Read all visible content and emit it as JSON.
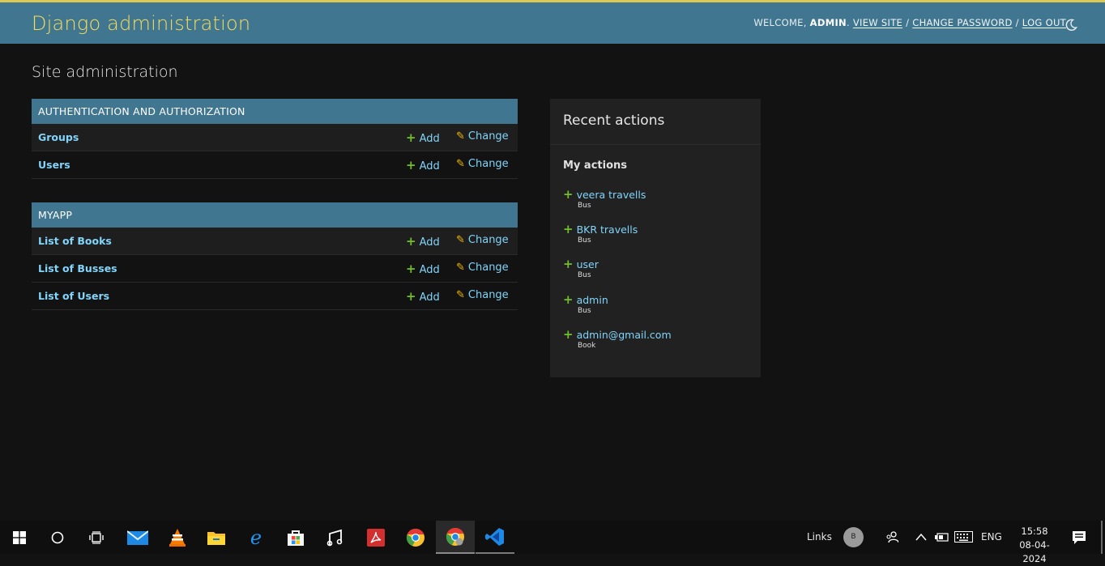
{
  "header": {
    "brand": "Django administration",
    "welcome": "WELCOME,",
    "username": "ADMIN",
    "view_site": "VIEW SITE",
    "change_password": "CHANGE PASSWORD",
    "log_out": "LOG OUT",
    "separator": "/",
    "theme_icon": "moon-icon"
  },
  "page_title": "Site administration",
  "modules": [
    {
      "caption": "AUTHENTICATION AND AUTHORIZATION",
      "models": [
        {
          "name": "Groups",
          "add": "Add",
          "change": "Change"
        },
        {
          "name": "Users",
          "add": "Add",
          "change": "Change"
        }
      ]
    },
    {
      "caption": "MYAPP",
      "models": [
        {
          "name": "List of Books",
          "add": "Add",
          "change": "Change"
        },
        {
          "name": "List of Busses",
          "add": "Add",
          "change": "Change"
        },
        {
          "name": "List of Users",
          "add": "Add",
          "change": "Change"
        }
      ]
    }
  ],
  "recent_actions": {
    "title": "Recent actions",
    "subtitle": "My actions",
    "items": [
      {
        "name": "veera travells",
        "type": "Bus"
      },
      {
        "name": "BKR travells",
        "type": "Bus"
      },
      {
        "name": "user",
        "type": "Bus"
      },
      {
        "name": "admin",
        "type": "Bus"
      },
      {
        "name": "admin@gmail.com",
        "type": "Book"
      }
    ]
  },
  "taskbar": {
    "links_label": "Links",
    "avatar_letter": "B",
    "language": "ENG",
    "time": "15:58",
    "date": "08-04-2024",
    "icons": [
      "windows-start-icon",
      "search-icon",
      "task-view-icon",
      "mail-icon",
      "vlc-icon",
      "file-explorer-icon",
      "edge-icon",
      "store-icon",
      "music-icon",
      "acrobat-icon",
      "chrome-icon",
      "chrome-profile-icon",
      "vscode-icon"
    ]
  },
  "colors": {
    "header_bg": "#417690",
    "brand": "#f5dd5d",
    "link": "#81d4fa",
    "add_plus": "#70bf2b",
    "change_pencil": "#efb80b",
    "page_bg": "#121212"
  }
}
